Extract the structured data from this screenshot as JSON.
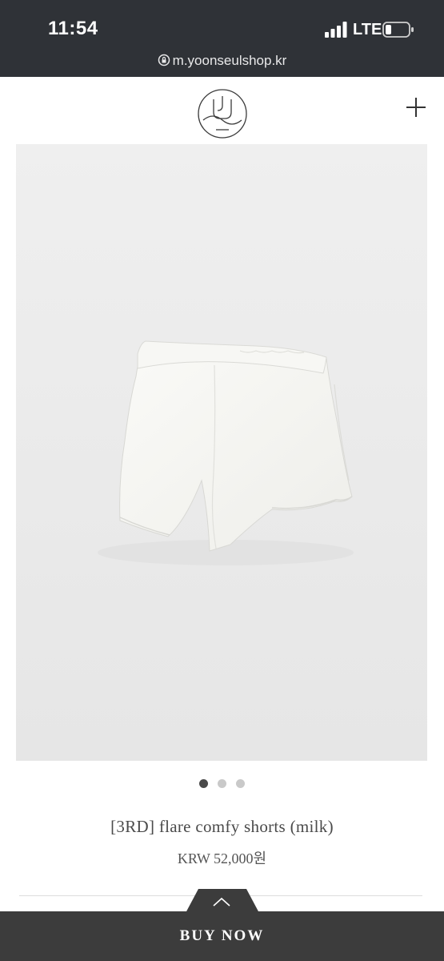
{
  "status_bar": {
    "time": "11:54",
    "network": "LTE",
    "icons": [
      "signal-icon",
      "battery-icon",
      "lock-icon"
    ]
  },
  "browser": {
    "url": "m.yoonseulshop.kr"
  },
  "header": {
    "logo_icon": "brand-logo",
    "menu_icon": "plus-icon"
  },
  "gallery": {
    "image_count": 3,
    "active_index": 0,
    "background_color": "#ebebeb"
  },
  "product": {
    "name": "[3RD] flare comfy shorts (milk)",
    "price": "KRW 52,000원"
  },
  "action_bar": {
    "buy_label": "BUY NOW",
    "expand_icon": "chevron-up-icon",
    "background_color": "#3c3c3c"
  },
  "colors": {
    "status_bar": "#2f3237",
    "text": "#4a4a4a"
  }
}
